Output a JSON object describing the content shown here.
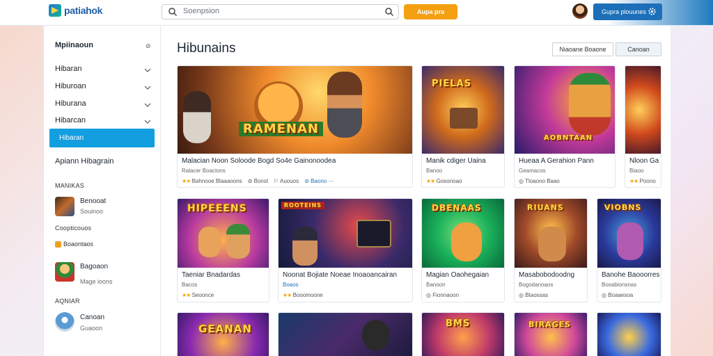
{
  "header": {
    "logo_text": "patiahok",
    "search_placeholder": "Soenpsion",
    "orange_button": "Aupa pra",
    "user_button": "Gupra plouunes"
  },
  "sidebar": {
    "heading": "Mpiinaoun",
    "heading_icon": "⊘",
    "items": [
      {
        "label": "Hibaran"
      },
      {
        "label": "Hiburoan"
      },
      {
        "label": "Hiburana"
      },
      {
        "label": "Hibarcan"
      }
    ],
    "active_item": "Hibaran",
    "section_title": "Apiann Hibagrain",
    "sub1": "MANIKAS",
    "entry1": {
      "title": "Benooat",
      "sub": "Souinoo"
    },
    "sub2": "Coopticouos",
    "badge": "Boaontaos",
    "entry2": {
      "title": "Bagoaon",
      "sub": "Mage ioons"
    },
    "sub3": "AQNIAR",
    "entry3": {
      "title": "Canoan",
      "sub": "Guaoon"
    }
  },
  "main": {
    "title": "Hibunains",
    "btn_filter": "Niaoane Boaone",
    "btn_sort": "Canoan",
    "cards": [
      {
        "title": "Malacian Noon Soloode Bogd So4e Gainonoodea",
        "sub": "Ralacer Boacions",
        "rating": "Bahnooe Blaaaoons",
        "tag1": "Bonst",
        "tag2": "Auouos",
        "tag3": "Baono",
        "logo": "RAMENAN"
      },
      {
        "title": "Manik cdiger Uaina",
        "sub": "Banoo",
        "rating": "Gosonoao",
        "logo": "PIELAS"
      },
      {
        "title": "Hueaa A Gerahion Pann",
        "sub": "Geamacos",
        "rating": "Tloaono Baao",
        "logo": "AOBNTAAN"
      },
      {
        "title": "Nloon Ga",
        "sub": "Biaoo",
        "rating": "Poono",
        "logo": ""
      },
      {
        "title": "Taeniar Bnadardas",
        "sub": "Bacos",
        "rating": "Seoonce",
        "logo": "HIPEEENS"
      },
      {
        "title": "Noonat Bojiate Noeae Inoaoancairan",
        "sub": "Boaos",
        "rating": "Booomoone",
        "logo": "ROOTEINS"
      },
      {
        "title": "Magian Oaohegaian",
        "sub": "Banoon",
        "rating": "Fionnaoon",
        "logo": "DBENAAS"
      },
      {
        "title": "Masabobodoodng",
        "sub": "Bogodanoaos",
        "rating": "Btaossas",
        "logo": "RIUANS"
      },
      {
        "title": "Banohe Baooorres",
        "sub": "Bosabionsnas",
        "rating": "Boaaesoa",
        "logo": "VIOBNS"
      },
      {
        "logo": "GEANAN"
      },
      {
        "logo": ""
      },
      {
        "logo": "BMS"
      },
      {
        "logo": "BIRAGES"
      },
      {
        "logo": ""
      }
    ]
  },
  "colors": {
    "accent": "#139ee0",
    "orange": "#f4a012",
    "brand_blue": "#1c6fb8"
  }
}
